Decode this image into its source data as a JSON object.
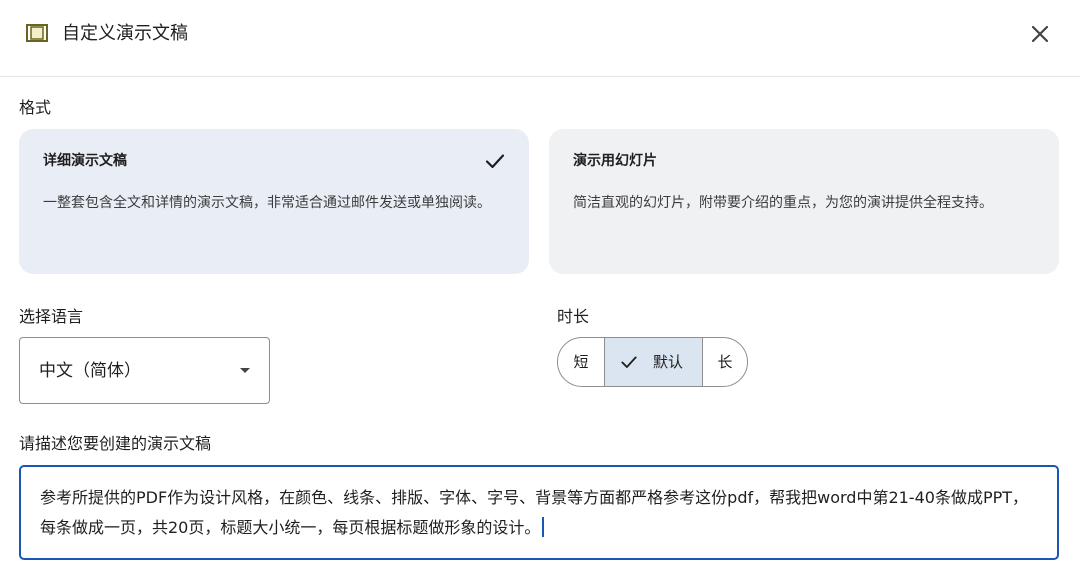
{
  "dialog": {
    "title": "自定义演示文稿",
    "icon": "presentation-icon",
    "close_icon": "close-icon"
  },
  "format": {
    "label": "格式",
    "options": [
      {
        "title": "详细演示文稿",
        "description": "一整套包含全文和详情的演示文稿，非常适合通过邮件发送或单独阅读。",
        "selected": true
      },
      {
        "title": "演示用幻灯片",
        "description": "简洁直观的幻灯片，附带要介绍的重点，为您的演讲提供全程支持。",
        "selected": false
      }
    ]
  },
  "language": {
    "label": "选择语言",
    "value": "中文（简体）"
  },
  "duration": {
    "label": "时长",
    "options": [
      "短",
      "默认",
      "长"
    ],
    "selected": "默认"
  },
  "prompt": {
    "label": "请描述您要创建的演示文稿",
    "value": "参考所提供的PDF作为设计风格，在颜色、线条、排版、字体、字号、背景等方面都严格参考这份pdf，帮我把word中第21-40条做成PPT，每条做成一页，共20页，标题大小统一，每页根据标题做形象的设计。"
  },
  "colors": {
    "accent": "#1a57b5",
    "selected_card": "#e9eef6",
    "card": "#f0f1f3",
    "segment_selected": "#dbe4f1"
  }
}
